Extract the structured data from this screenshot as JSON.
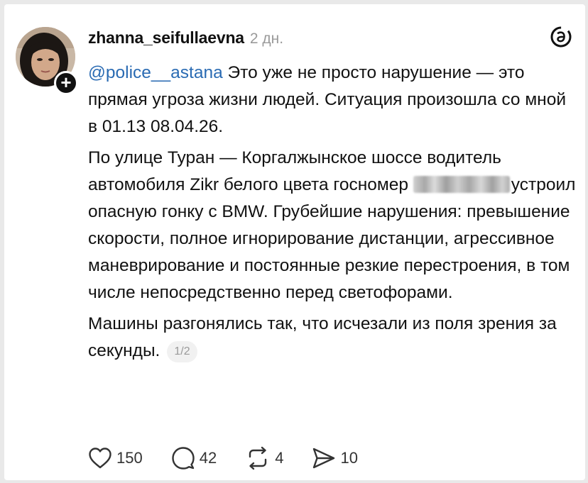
{
  "post": {
    "username": "zhanna_seifullaevna",
    "time": "2 дн.",
    "mention": "@police__astana",
    "paragraphs": {
      "p1_rest": " Это уже не просто нарушение — это прямая угроза жизни людей. Ситуация произошла со мной в 01.13 08.04.26.",
      "p2_before_plate": "По улице Туран — Коргалжынское шоссе водитель автомобиля Zikr белого цвета госномер ",
      "p2_after_plate": "устроил опасную гонку с BMW. Грубейшие нарушения: превышение скорости, полное игнорирование дистанции, агрессивное маневрирование и постоянные резкие перестроения, в том числе непосредственно перед светофорами.",
      "p3": "Машины разгонялись так, что исчезали из поля зрения за секунды."
    },
    "pager": "1/2"
  },
  "icons": {
    "avatar": "avatar-photo",
    "follow": "plus-icon",
    "app_logo": "threads-logo-icon",
    "like": "heart-icon",
    "reply": "comment-bubble-icon",
    "repost": "repost-icon",
    "share": "send-icon"
  },
  "actions": {
    "likes": "150",
    "replies": "42",
    "reposts": "4",
    "shares": "10"
  },
  "colors": {
    "mention": "#2a6bb3",
    "muted": "#9a9a9a",
    "background": "#ffffff"
  }
}
